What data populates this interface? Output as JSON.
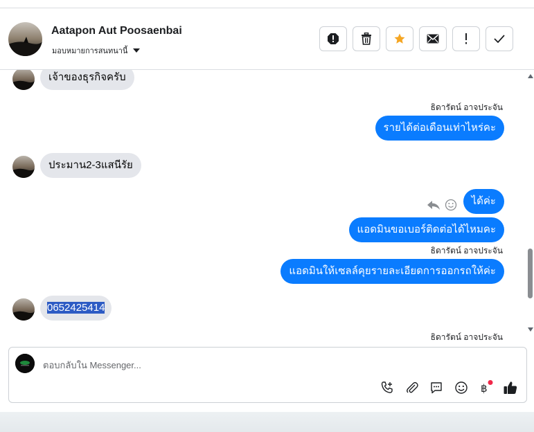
{
  "header": {
    "contact_name": "Aatapon Aut Poosaenbai",
    "assign_label": "มอบหมายการสนทนานี้"
  },
  "toolbar": {
    "buttons": [
      {
        "name": "report-spam-icon",
        "color": "#1c1e21"
      },
      {
        "name": "trash-icon",
        "color": "#1c1e21"
      },
      {
        "name": "star-icon",
        "color": "#f5a623"
      },
      {
        "name": "envelope-icon",
        "color": "#1c1e21"
      },
      {
        "name": "exclamation-icon",
        "color": "#1c1e21"
      },
      {
        "name": "checkmark-icon",
        "color": "#1c1e21"
      }
    ]
  },
  "messages": [
    {
      "from": "them",
      "text": "เจ้าของธุรกิจครับ"
    },
    {
      "from": "page",
      "sender": "ธิดารัตน์ อาจประจัน",
      "text": "รายได้ต่อเดือนเท่าไหร่คะ"
    },
    {
      "from": "them",
      "text": "ประมาน2-3แสนีรัย"
    },
    {
      "from": "page",
      "text": "ได้ค่ะ"
    },
    {
      "from": "page",
      "text": "แอดมินขอเบอร์ติดต่อได้ไหมคะ"
    },
    {
      "from": "page",
      "sender": "ธิดารัตน์ อาจประจัน",
      "text": "แอดมินให้เซลล์คุยรายละเอียดการออกรถให้ค่ะ"
    },
    {
      "from": "them",
      "text": "0652425414"
    },
    {
      "from": "page",
      "sender": "ธิดารัตน์ อาจประจัน"
    }
  ],
  "composer": {
    "placeholder": "ตอบกลับใน Messenger...",
    "icons": [
      "call-add-icon",
      "paperclip-icon",
      "chat-bubble-icon",
      "emoji-icon",
      "baht-icon",
      "thumbs-up-icon"
    ],
    "accent_color": "#0a7cff",
    "notification_dot_color": "#f02849"
  }
}
